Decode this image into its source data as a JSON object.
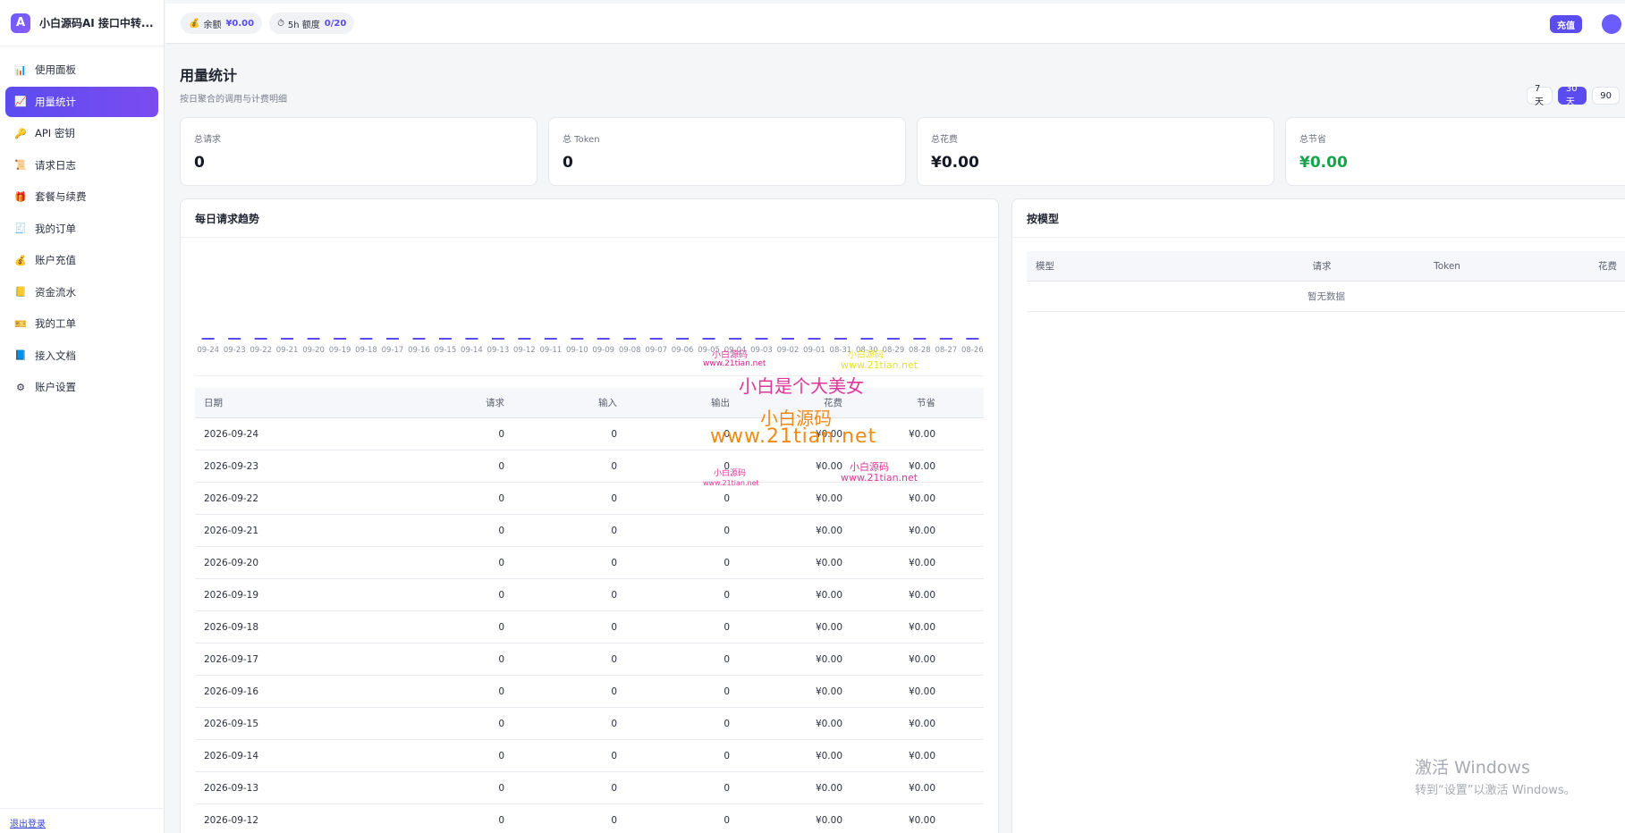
{
  "brand": {
    "logo_letter": "A",
    "name": "小白源码AI 接口中转..."
  },
  "sidebar": {
    "items": [
      {
        "label": "使用面板",
        "icon": "bar-chart-icon",
        "glyph": "📊",
        "active": false
      },
      {
        "label": "用量统计",
        "icon": "trend-chart-icon",
        "glyph": "📈",
        "active": true
      },
      {
        "label": "API 密钥",
        "icon": "key-icon",
        "glyph": "🔑",
        "active": false
      },
      {
        "label": "请求日志",
        "icon": "scroll-icon",
        "glyph": "📜",
        "active": false
      },
      {
        "label": "套餐与续费",
        "icon": "gift-icon",
        "glyph": "🎁",
        "active": false
      },
      {
        "label": "我的订单",
        "icon": "receipt-icon",
        "glyph": "🧾",
        "active": false
      },
      {
        "label": "账户充值",
        "icon": "money-bag-icon",
        "glyph": "💰",
        "active": false
      },
      {
        "label": "资金流水",
        "icon": "ledger-icon",
        "glyph": "📒",
        "active": false
      },
      {
        "label": "我的工单",
        "icon": "ticket-icon",
        "glyph": "🎫",
        "active": false
      },
      {
        "label": "接入文档",
        "icon": "book-icon",
        "glyph": "📘",
        "active": false
      },
      {
        "label": "账户设置",
        "icon": "gear-icon",
        "glyph": "⚙",
        "active": false
      }
    ],
    "logout": "退出登录"
  },
  "topbar": {
    "balance_label": "余额",
    "balance_value": "¥0.00",
    "quota_label": "5h 额度",
    "quota_value": "0/20",
    "recharge": "充值"
  },
  "page": {
    "title": "用量统计",
    "subtitle": "按日聚合的调用与计费明细",
    "ranges": [
      {
        "label": "7 天",
        "active": false
      },
      {
        "label": "30 天",
        "active": true
      },
      {
        "label": "90",
        "active": false
      }
    ]
  },
  "stats": [
    {
      "label": "总请求",
      "value": "0"
    },
    {
      "label": "总 Token",
      "value": "0"
    },
    {
      "label": "总花费",
      "value": "¥0.00"
    },
    {
      "label": "总节省",
      "value": "¥0.00"
    }
  ],
  "daily_panel": {
    "title": "每日请求趋势",
    "headers": {
      "date": "日期",
      "requests": "请求",
      "input": "输入",
      "output": "输出",
      "cost": "花费",
      "saved": "节省"
    },
    "rows": [
      [
        "2026-09-24",
        "0",
        "0",
        "0",
        "¥0.00",
        "¥0.00"
      ],
      [
        "2026-09-23",
        "0",
        "0",
        "0",
        "¥0.00",
        "¥0.00"
      ],
      [
        "2026-09-22",
        "0",
        "0",
        "0",
        "¥0.00",
        "¥0.00"
      ],
      [
        "2026-09-21",
        "0",
        "0",
        "0",
        "¥0.00",
        "¥0.00"
      ],
      [
        "2026-09-20",
        "0",
        "0",
        "0",
        "¥0.00",
        "¥0.00"
      ],
      [
        "2026-09-19",
        "0",
        "0",
        "0",
        "¥0.00",
        "¥0.00"
      ],
      [
        "2026-09-18",
        "0",
        "0",
        "0",
        "¥0.00",
        "¥0.00"
      ],
      [
        "2026-09-17",
        "0",
        "0",
        "0",
        "¥0.00",
        "¥0.00"
      ],
      [
        "2026-09-16",
        "0",
        "0",
        "0",
        "¥0.00",
        "¥0.00"
      ],
      [
        "2026-09-15",
        "0",
        "0",
        "0",
        "¥0.00",
        "¥0.00"
      ],
      [
        "2026-09-14",
        "0",
        "0",
        "0",
        "¥0.00",
        "¥0.00"
      ],
      [
        "2026-09-13",
        "0",
        "0",
        "0",
        "¥0.00",
        "¥0.00"
      ],
      [
        "2026-09-12",
        "0",
        "0",
        "0",
        "¥0.00",
        "¥0.00"
      ]
    ]
  },
  "chart_data": {
    "type": "bar",
    "categories": [
      "09-24",
      "09-23",
      "09-22",
      "09-21",
      "09-20",
      "09-19",
      "09-18",
      "09-17",
      "09-16",
      "09-15",
      "09-14",
      "09-13",
      "09-12",
      "09-11",
      "09-10",
      "09-09",
      "09-08",
      "09-07",
      "09-06",
      "09-05",
      "09-04",
      "09-03",
      "09-02",
      "09-01",
      "08-31",
      "08-30",
      "08-29",
      "08-28",
      "08-27",
      "08-26"
    ],
    "values": [
      0,
      0,
      0,
      0,
      0,
      0,
      0,
      0,
      0,
      0,
      0,
      0,
      0,
      0,
      0,
      0,
      0,
      0,
      0,
      0,
      0,
      0,
      0,
      0,
      0,
      0,
      0,
      0,
      0,
      0
    ],
    "title": "每日请求趋势",
    "bar_color": "#5b4cf0"
  },
  "model_panel": {
    "title": "按模型",
    "headers": {
      "model": "模型",
      "requests": "请求",
      "token": "Token",
      "cost": "花费"
    },
    "empty": "暂无数据"
  },
  "watermarks": {
    "w1": "小白是个大美女",
    "w2": "小白源码",
    "w3": "www.21tian.net",
    "w4": "小白源码",
    "w5": "www.21tian.net",
    "w6": "小白源码",
    "w7": "www.21tian.net"
  },
  "os_notice": {
    "line1": "激活 Windows",
    "line2": "转到“设置”以激活 Windows。"
  }
}
